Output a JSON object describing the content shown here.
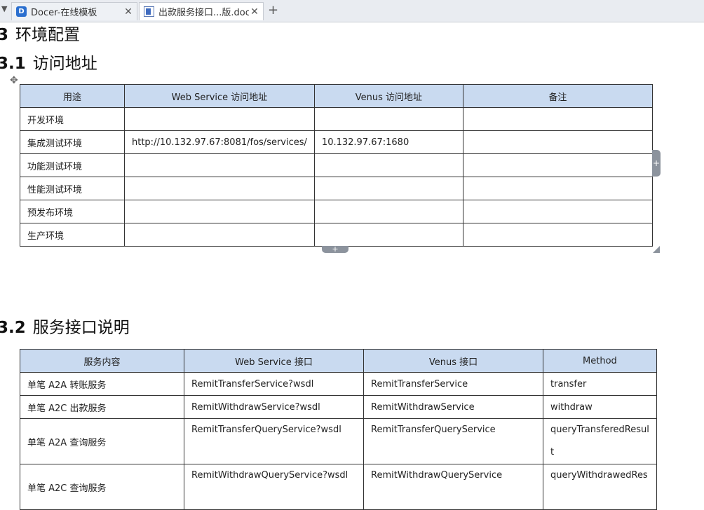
{
  "tabs": [
    {
      "label": "Docer-在线模板",
      "icon": "docer-icon",
      "active": false
    },
    {
      "label": "出款服务接口...版.docx",
      "icon": "word-doc-icon",
      "active": true
    }
  ],
  "tab_controls": {
    "close": "✕",
    "new": "+",
    "scroll_left": "▼"
  },
  "document": {
    "heading_section": {
      "num": "3",
      "text": "环境配置"
    },
    "heading_access": {
      "num": "3.1",
      "text": "访问地址"
    },
    "heading_service": {
      "num": "3.2",
      "text": "服务接口说明"
    },
    "env_table": {
      "headers": [
        "用途",
        "Web Service 访问地址",
        "Venus 访问地址",
        "备注"
      ],
      "rows": [
        [
          "开发环境",
          "",
          "",
          ""
        ],
        [
          "集成测试环境",
          "http://10.132.97.67:8081/fos/services/",
          "10.132.97.67:1680",
          ""
        ],
        [
          "功能测试环境",
          "",
          "",
          ""
        ],
        [
          "性能测试环境",
          "",
          "",
          ""
        ],
        [
          "预发布环境",
          "",
          "",
          ""
        ],
        [
          "生产环境",
          "",
          "",
          ""
        ]
      ]
    },
    "svc_table": {
      "headers": [
        "服务内容",
        "Web Service 接口",
        "Venus 接口",
        "Method"
      ],
      "rows": [
        [
          "单笔 A2A 转账服务",
          "RemitTransferService?wsdl",
          "RemitTransferService",
          "transfer"
        ],
        [
          "单笔 A2C 出款服务",
          "RemitWithdrawService?wsdl",
          "RemitWithdrawService",
          "withdraw"
        ],
        [
          "单笔 A2A 查询服务",
          "RemitTransferQueryService?wsdl",
          "RemitTransferQueryService",
          "queryTransferedResul",
          "t"
        ],
        [
          "单笔 A2C 查询服务",
          "RemitWithdrawQueryService?wsdl",
          "RemitWithdrawQueryService",
          "queryWithdrawedRes"
        ]
      ]
    },
    "table_controls": {
      "move": "✥",
      "add_column": "+",
      "add_row": "+"
    }
  }
}
